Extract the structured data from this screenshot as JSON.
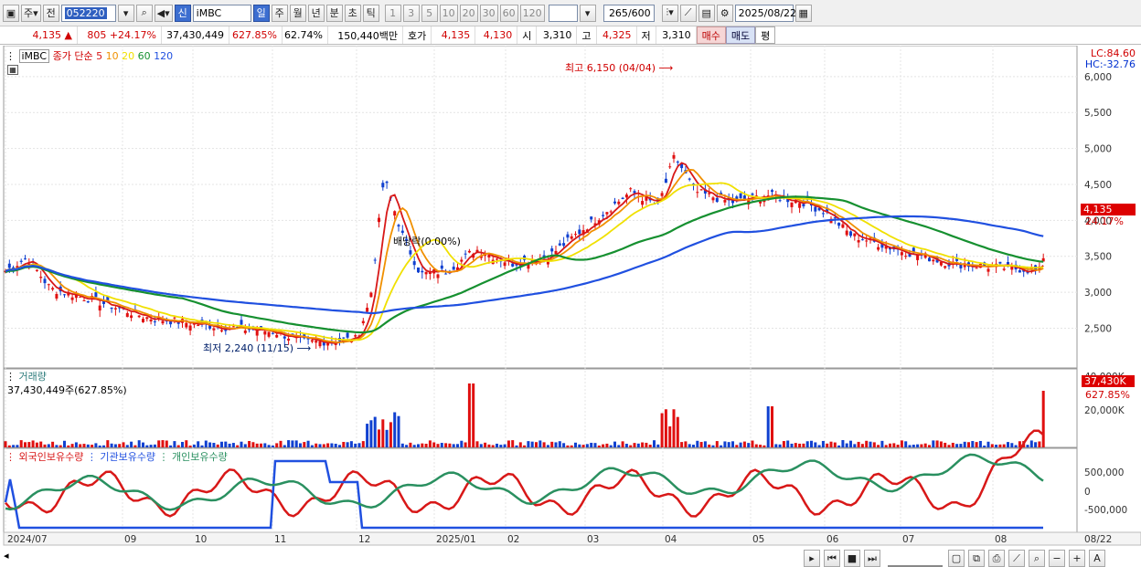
{
  "toolbar": {
    "type_label": "주",
    "prev_label": "전",
    "code": "052220",
    "name": "iMBC",
    "new_label": "신",
    "periods": [
      "일",
      "주",
      "월",
      "년",
      "분",
      "초",
      "틱"
    ],
    "selected_period": "일",
    "intervals": [
      "1",
      "3",
      "5",
      "10",
      "20",
      "30",
      "60",
      "120"
    ],
    "count": "265",
    "count_total": "/600",
    "date": "2025/08/22"
  },
  "quote": {
    "price": "4,135",
    "arrow": "▲",
    "change": "805",
    "change_pct": "+24.17%",
    "volume": "37,430,449",
    "vol_ratio": "627.85%",
    "turnover": "62.74%",
    "amount": "150,440백만",
    "hoga_label": "호가",
    "hoga_ask": "4,135",
    "hoga_bid": "4,130",
    "open_label": "시",
    "open": "3,310",
    "high_label": "고",
    "high": "4,325",
    "low_label": "저",
    "low": "3,310",
    "buy_label": "매수",
    "sell_label": "매도",
    "eval_label": "평"
  },
  "price_panel": {
    "name_tag": "iMBC",
    "ma_label": "종가 단순",
    "ma_periods": [
      "5",
      "10",
      "20",
      "60",
      "120"
    ],
    "ma_colors": [
      "#d81818",
      "#f09000",
      "#f0e000",
      "#169030",
      "#2050e0"
    ],
    "lc": "LC:84.60",
    "hc": "HC:-32.76",
    "last_price": "4,135",
    "last_pct": "24.17%",
    "max_note": "최고 6,150 (04/04)",
    "min_note": "최저 2,240 (11/15)",
    "vi_note": "배당락(0.00%)",
    "y_ticks": [
      "6,000",
      "5,500",
      "5,000",
      "4,500",
      "4,000",
      "3,500",
      "3,000",
      "2,500"
    ]
  },
  "volume_panel": {
    "title": "거래량",
    "value": "37,430,449주(627.85%)",
    "last": "37,430K",
    "last_pct": "627.85%",
    "y_ticks": [
      "40,000K",
      "20,000K"
    ]
  },
  "holding_panel": {
    "legend": [
      "외국인보유수량",
      "기관보유수량",
      "개인보유수량"
    ],
    "legend_colors": [
      "#d81818",
      "#2050e0",
      "#2a9060"
    ],
    "y_ticks": [
      "500,000",
      "0",
      "-500,000"
    ]
  },
  "x_axis": {
    "labels": [
      "2024/07",
      "09",
      "10",
      "11",
      "12",
      "2025/01",
      "02",
      "03",
      "04",
      "05",
      "06",
      "07",
      "08"
    ],
    "end_label": "08/22"
  },
  "chart_data": {
    "type": "candlestick",
    "title": "iMBC",
    "x_range": [
      "2024/07",
      "2025/08/22"
    ],
    "ylim": [
      2240,
      6150
    ],
    "annotations": [
      {
        "text": "최고 6,150 (04/04)",
        "value": 6150
      },
      {
        "text": "최저 2,240 (11/15)",
        "value": 2240
      }
    ],
    "series": [
      {
        "name": "5",
        "color": "#d81818"
      },
      {
        "name": "10",
        "color": "#f09000"
      },
      {
        "name": "20",
        "color": "#f0e000"
      },
      {
        "name": "60",
        "color": "#169030"
      },
      {
        "name": "120",
        "color": "#2050e0"
      }
    ]
  }
}
